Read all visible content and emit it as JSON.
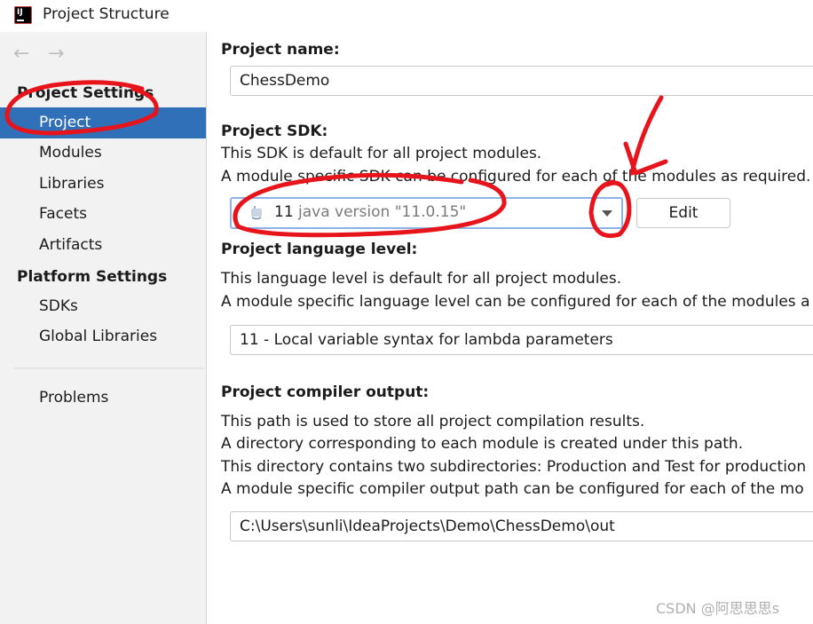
{
  "window": {
    "title": "Project Structure",
    "app_icon": "intellij-idea-icon"
  },
  "nav": {
    "back": "←",
    "forward": "→"
  },
  "sidebar": {
    "project_settings_title": "Project Settings",
    "project_items": [
      {
        "label": "Project",
        "selected": true
      },
      {
        "label": "Modules"
      },
      {
        "label": "Libraries"
      },
      {
        "label": "Facets"
      },
      {
        "label": "Artifacts"
      }
    ],
    "platform_settings_title": "Platform Settings",
    "platform_items": [
      {
        "label": "SDKs"
      },
      {
        "label": "Global Libraries"
      }
    ],
    "other_items": [
      {
        "label": "Problems"
      }
    ]
  },
  "main": {
    "project_name": {
      "heading": "Project name:",
      "value": "ChessDemo"
    },
    "project_sdk": {
      "heading": "Project SDK:",
      "desc1": "This SDK is default for all project modules.",
      "desc2": "A module specific SDK can be configured for each of the modules as required.",
      "selected_version": "11",
      "selected_detail": "java version \"11.0.15\"",
      "edit_label": "Edit"
    },
    "language_level": {
      "heading": "Project language level:",
      "desc1": "This language level is default for all project modules.",
      "desc2": "A module specific language level can be configured for each of the modules a",
      "value": "11 - Local variable syntax for lambda parameters"
    },
    "compiler_output": {
      "heading": "Project compiler output:",
      "desc1": "This path is used to store all project compilation results.",
      "desc2": "A directory corresponding to each module is created under this path.",
      "desc3": "This directory contains two subdirectories: Production and Test for production",
      "desc4": "A module specific compiler output path can be configured for each of the mo",
      "value": "C:\\Users\\sunli\\IdeaProjects\\Demo\\ChessDemo\\out"
    }
  },
  "watermark": "CSDN @阿思思思s",
  "colors": {
    "selection": "#2f70b8",
    "annotation": "#e8141c",
    "sidebar_bg": "#f2f2f2"
  }
}
